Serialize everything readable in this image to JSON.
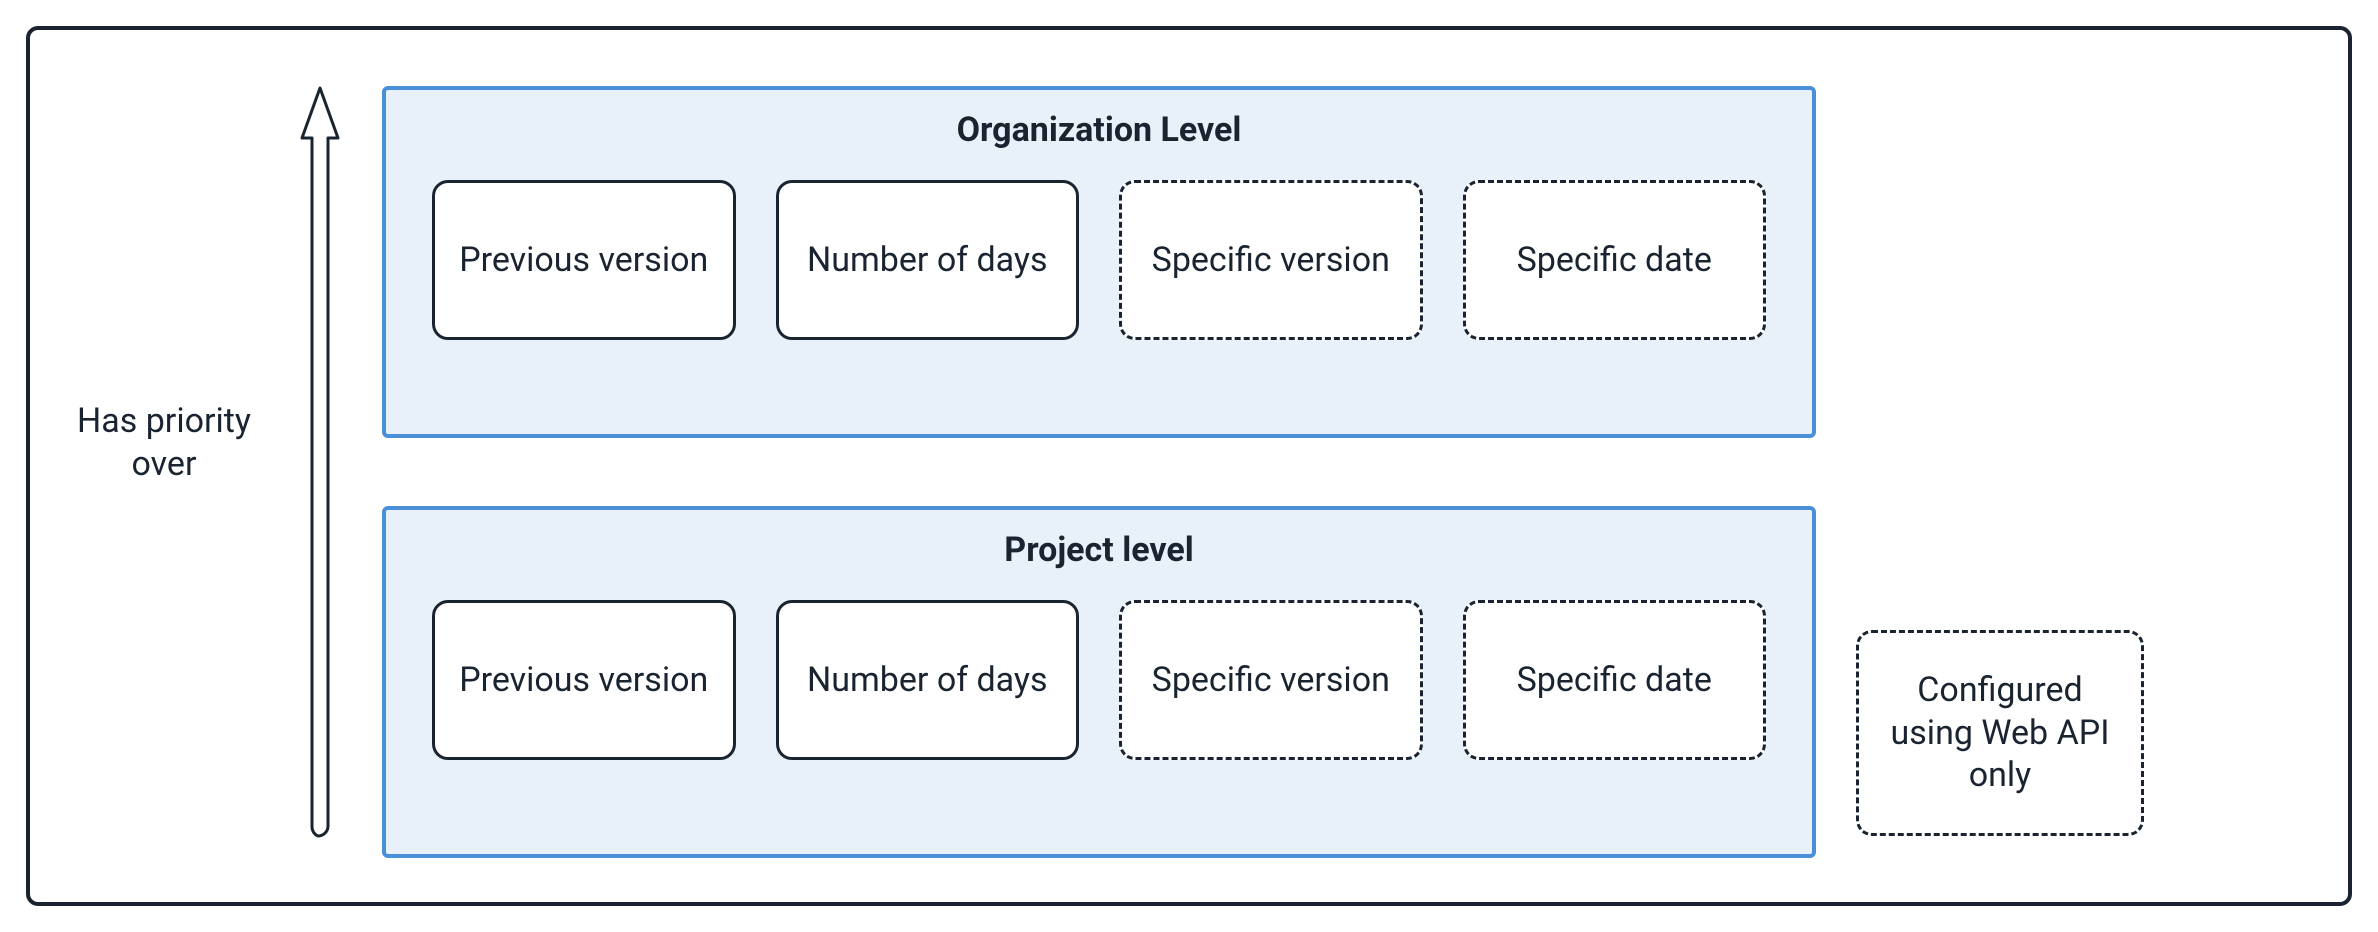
{
  "priority_label": "Has priority over",
  "org": {
    "title": "Organization Level",
    "options": {
      "previous_version": "Previous version",
      "number_of_days": "Number of days",
      "specific_version": "Specific version",
      "specific_date": "Specific date"
    }
  },
  "project": {
    "title": "Project level",
    "options": {
      "previous_version": "Previous version",
      "number_of_days": "Number of days",
      "specific_version": "Specific version",
      "specific_date": "Specific date"
    }
  },
  "legend": "Configured using Web API only",
  "colors": {
    "frame_border": "#1a2430",
    "level_border": "#4a90d9",
    "level_bg": "#e8f0fa"
  }
}
